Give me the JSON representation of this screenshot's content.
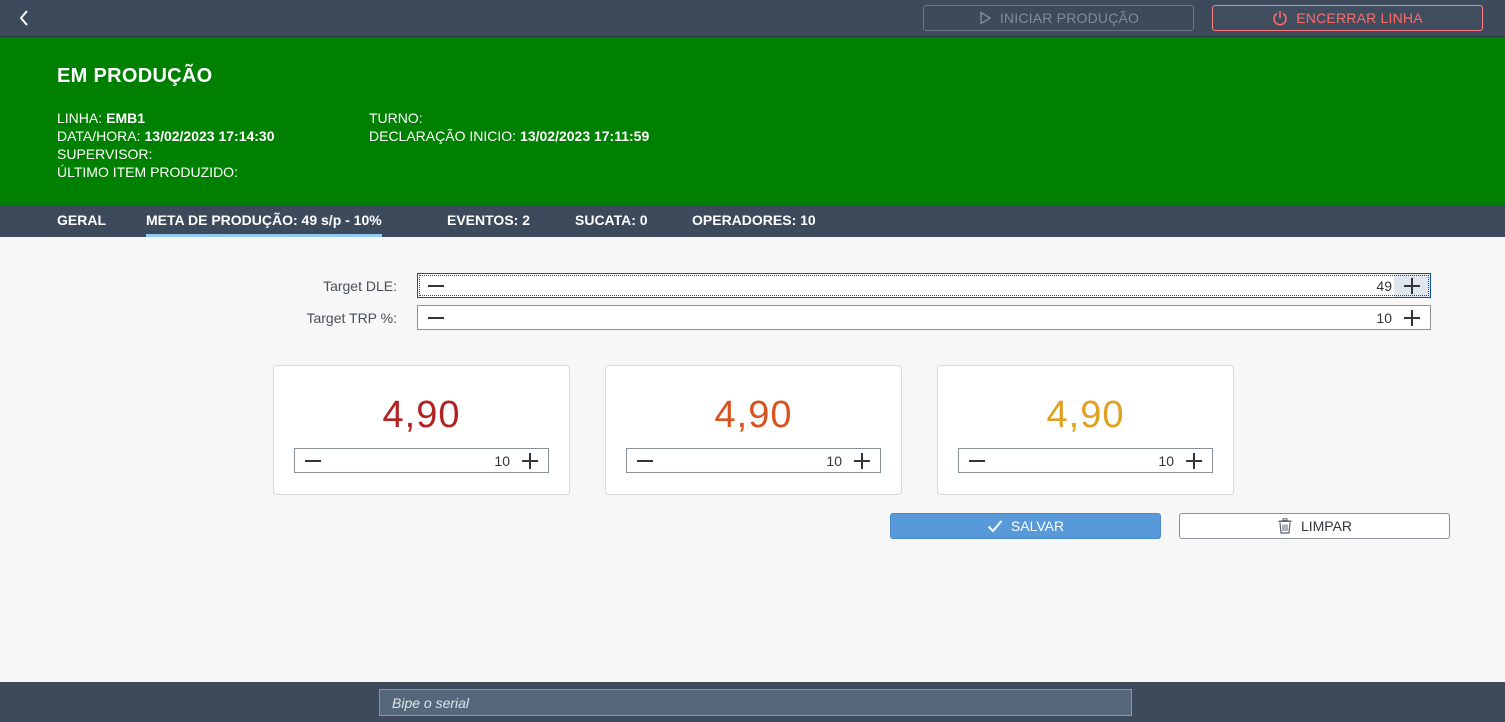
{
  "header": {
    "start_button": "INICIAR PRODUÇÃO",
    "end_button": "ENCERRAR LINHA"
  },
  "status": {
    "title": "EM PRODUÇÃO",
    "linha_label": "LINHA:",
    "linha_value": "EMB1",
    "datahora_label": "DATA/HORA:",
    "datahora_value": "13/02/2023 17:14:30",
    "supervisor_label": "SUPERVISOR:",
    "ultimo_label": "ÚLTIMO ITEM PRODUZIDO:",
    "turno_label": "TURNO:",
    "declaracao_label": "DECLARAÇÃO INICIO:",
    "declaracao_value": "13/02/2023 17:11:59",
    "background_color": "#008000"
  },
  "tabs": [
    {
      "label": "GERAL"
    },
    {
      "label": "META DE PRODUÇÃO: 49 s/p - 10%"
    },
    {
      "label": "EVENTOS: 2"
    },
    {
      "label": "SUCATA: 0"
    },
    {
      "label": "OPERADORES: 10"
    }
  ],
  "form": {
    "target_dle_label": "Target DLE:",
    "target_dle_value": "49",
    "target_trp_label": "Target TRP %:",
    "target_trp_value": "10"
  },
  "cards": [
    {
      "value": "4,90",
      "step": "10",
      "color": "#b22222"
    },
    {
      "value": "4,90",
      "step": "10",
      "color": "#d9531e"
    },
    {
      "value": "4,90",
      "step": "10",
      "color": "#e0a020"
    }
  ],
  "actions": {
    "save": "SALVAR",
    "clear": "LIMPAR"
  },
  "footer": {
    "serial_placeholder": "Bipe o serial"
  }
}
